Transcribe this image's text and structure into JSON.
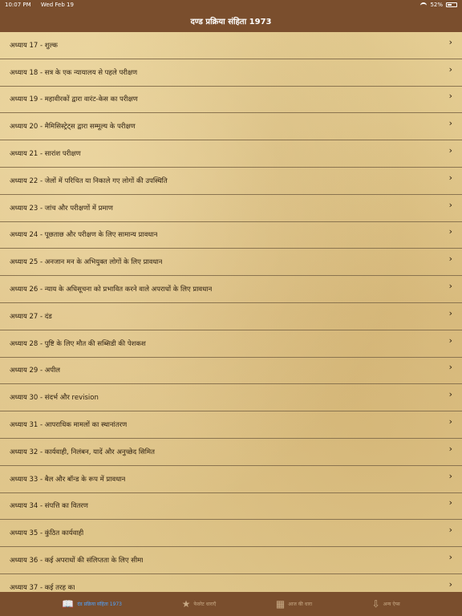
{
  "status": {
    "time": "10:07 PM",
    "date": "Wed Feb 19",
    "battery": "52%",
    "battery_level": 0.52
  },
  "header": {
    "title": "दण्ड प्रक्रिया संहिता 1973"
  },
  "chapters": [
    {
      "label": "अध्याय 17 - शुल्क"
    },
    {
      "label": "अध्याय 18 - सत्र के एक न्यायालय से पहले परीक्षण"
    },
    {
      "label": "अध्याय 19 - महावीरकों द्वारा वारंट-केस का परीक्षण"
    },
    {
      "label": "अध्याय 20 - मैमिसिस्ट्रेट्स द्वारा सम्मूल्य के परीक्षण"
    },
    {
      "label": "अध्याय 21 - सारांश परीक्षण"
    },
    {
      "label": "अध्याय 22 - जेलों में परिचित या निकाले गए लोगों की उपस्थिति"
    },
    {
      "label": "अध्याय 23 - जांच और परीक्षणों में प्रमाण"
    },
    {
      "label": "अध्याय 24 - पूछताछ और परीक्षण के लिए सामान्य प्रावधान"
    },
    {
      "label": "अध्याय 25 - अनजान मन के अभियुक्त लोगों के लिए प्रावधान"
    },
    {
      "label": "अध्याय 26 - न्याय के अधिसूचना को प्रभावित करने वाले अपराधों के लिए प्रावधान"
    },
    {
      "label": "अध्याय 27 - दंड"
    },
    {
      "label": "अध्याय 28 - पुष्टि के लिए मौत की सब्सिडी की पेशकश"
    },
    {
      "label": "अध्याय 29 - अपील"
    },
    {
      "label": "अध्याय 30 - संदर्भ और revision"
    },
    {
      "label": "अध्याय 31 - आपराधिक मामलों का स्थानांतरण"
    },
    {
      "label": "अध्याय 32 - कार्यवाही, निलंबन, यादें और अनुच्छेद सिमित"
    },
    {
      "label": "अध्याय 33 - बैल और बॉन्ड के रूप में प्रावधान"
    },
    {
      "label": "अध्याय 34 - संपत्ति का वितरण"
    },
    {
      "label": "अध्याय 35 - कुंठित कार्यवाही"
    },
    {
      "label": "अध्याय 36 - कई अपराधों की संलिप्तता के लिए सीमा"
    },
    {
      "label": "अध्याय 37 - कई तरह का"
    }
  ],
  "chevron": "›",
  "tabs": [
    {
      "label": "दंड प्रक्रिया संहिता 1973",
      "icon": "book-icon",
      "glyph": "📖",
      "active": true
    },
    {
      "label": "फेवरेट धाराएँ",
      "icon": "star-icon",
      "glyph": "★",
      "active": false
    },
    {
      "label": "आज की धारा",
      "icon": "calendar-icon",
      "glyph": "▦",
      "active": false
    },
    {
      "label": "अन्य ऐप्स",
      "icon": "download-icon",
      "glyph": "⇩",
      "active": false
    }
  ],
  "colors": {
    "bar": "#7a4e2d",
    "active_tab": "#4fa3ff",
    "inactive_tab": "#c8aa85",
    "text": "#2b1d0e"
  }
}
